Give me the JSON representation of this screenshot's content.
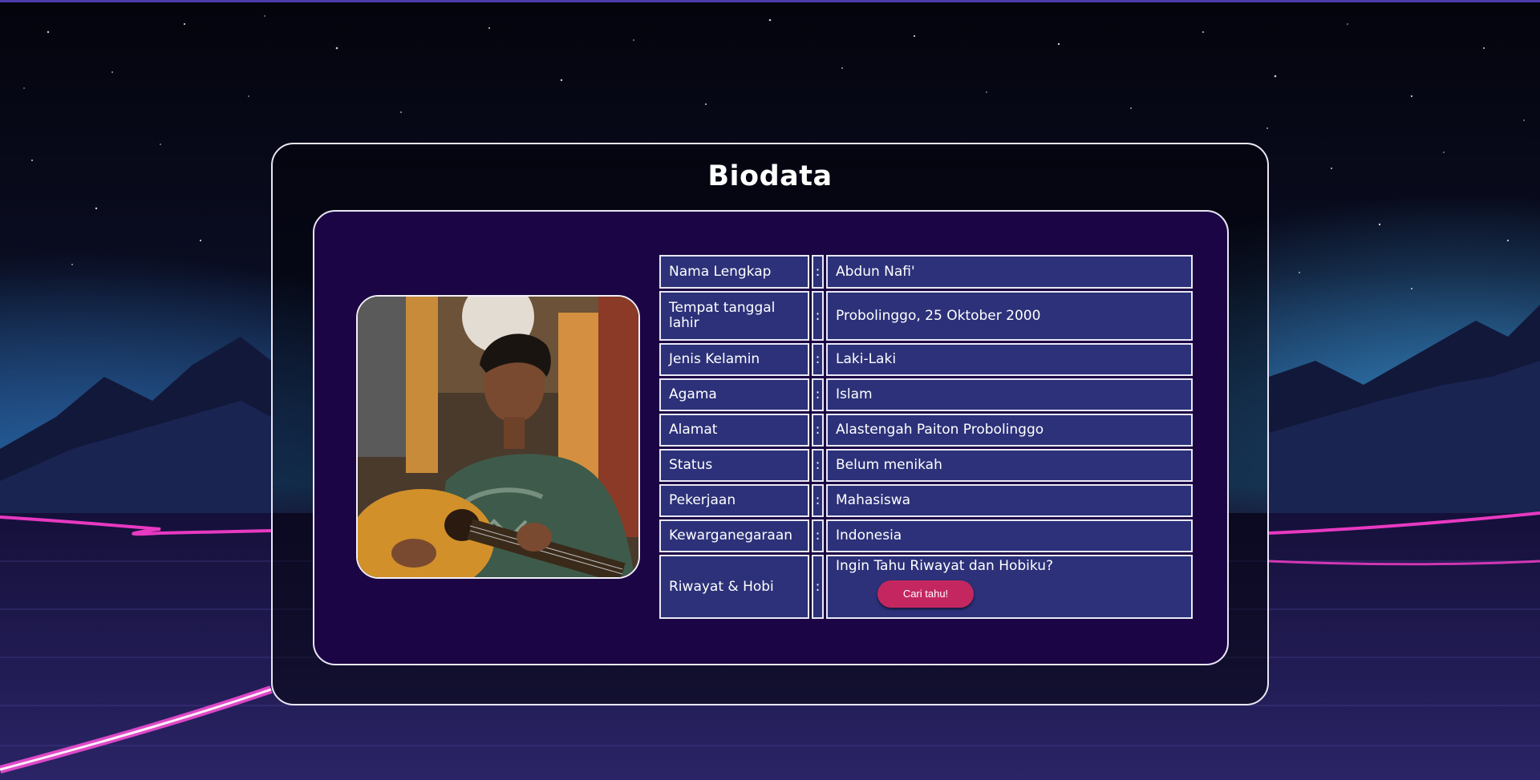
{
  "page": {
    "title": "Biodata"
  },
  "photo": {
    "subject": "portrait of a young man playing an acoustic guitar"
  },
  "biodata": {
    "separator": ":",
    "rows": [
      {
        "label": "Nama Lengkap",
        "value": "Abdun Nafi'"
      },
      {
        "label": "Tempat tanggal lahir",
        "value": "Probolinggo, 25 Oktober 2000"
      },
      {
        "label": "Jenis Kelamin",
        "value": "Laki-Laki"
      },
      {
        "label": "Agama",
        "value": "Islam"
      },
      {
        "label": "Alamat",
        "value": "Alastengah Paiton Probolinggo"
      },
      {
        "label": "Status",
        "value": "Belum menikah"
      },
      {
        "label": "Pekerjaan",
        "value": "Mahasiswa"
      },
      {
        "label": "Kewarganegaraan",
        "value": "Indonesia"
      },
      {
        "label": "Riwayat & Hobi",
        "value": "Ingin Tahu Riwayat dan Hobiku?"
      }
    ],
    "button_label": "Cari tahu!"
  },
  "colors": {
    "inner_panel": "#1c0544",
    "cell_background": "#2c3179",
    "button": "#c42760",
    "border": "#e9e6f5"
  }
}
